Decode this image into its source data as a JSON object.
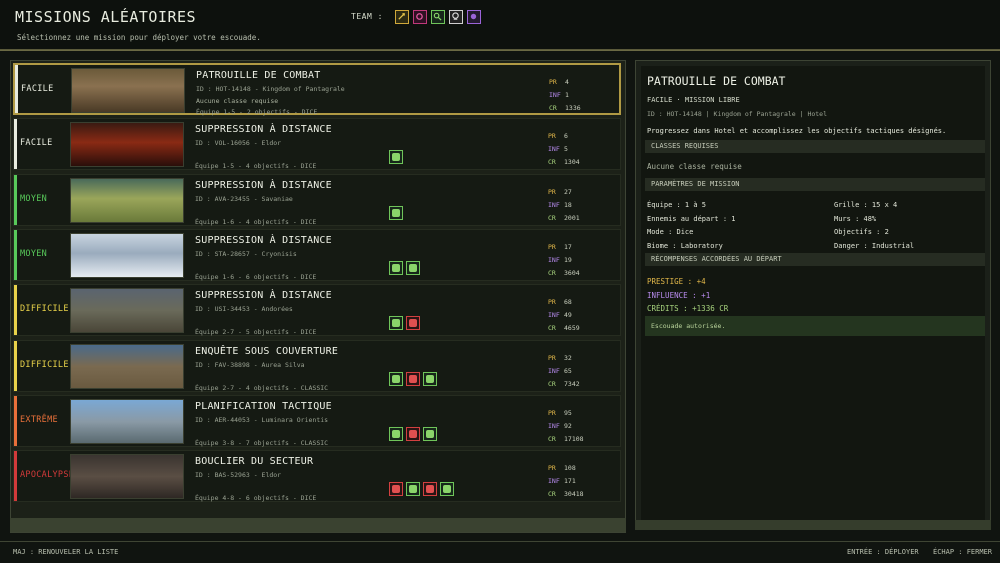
{
  "header": {
    "title": "MISSIONS ALÉATOIRES",
    "subtitle": "Sélectionnez une mission pour déployer votre escouade.",
    "team_label": "TEAM :",
    "team_icons": [
      "sword-class-icon",
      "bomb-class-icon",
      "scope-class-icon",
      "skull-class-icon",
      "rune-class-icon"
    ]
  },
  "colors": {
    "easy": "#e8ecdf",
    "medium": "#58c95a",
    "hard": "#e8d24a",
    "extreme": "#e8703a",
    "apocalypse": "#d23a3a",
    "selected_border": "#b09a44"
  },
  "missions": [
    {
      "difficulty": "FACILE",
      "name": "PATROUILLE DE COMBAT",
      "id_line": "ID : HOT-14148   -   Kingdom of Pantagrale",
      "requirement": "Aucune classe requise",
      "team_line": "Équipe 1-5    -    2 objectifs    -    DICE",
      "pr": "4",
      "inf": "1",
      "cr": "1336",
      "classes": []
    },
    {
      "difficulty": "FACILE",
      "name": "SUPPRESSION À DISTANCE",
      "id_line": "ID : VOL-16056   -   Eldor",
      "requirement": "",
      "team_line": "Équipe 1-5    -    4 objectifs    -    DICE",
      "pr": "6",
      "inf": "5",
      "cr": "1304",
      "classes": [
        "green"
      ]
    },
    {
      "difficulty": "MOYEN",
      "name": "SUPPRESSION À DISTANCE",
      "id_line": "ID : AVA-23455   -   Savaniae",
      "requirement": "",
      "team_line": "Équipe 1-6    -    4 objectifs    -    DICE",
      "pr": "27",
      "inf": "18",
      "cr": "2001",
      "classes": [
        "green"
      ]
    },
    {
      "difficulty": "MOYEN",
      "name": "SUPPRESSION À DISTANCE",
      "id_line": "ID : STA-28657   -   Cryonisis",
      "requirement": "",
      "team_line": "Équipe 1-6    -    6 objectifs    -    DICE",
      "pr": "17",
      "inf": "19",
      "cr": "3604",
      "classes": [
        "green",
        "green"
      ]
    },
    {
      "difficulty": "DIFFICILE",
      "name": "SUPPRESSION À DISTANCE",
      "id_line": "ID : USI-34453   -   Andorées",
      "requirement": "",
      "team_line": "Équipe 2-7    -    5 objectifs    -    DICE",
      "pr": "68",
      "inf": "49",
      "cr": "4659",
      "classes": [
        "green",
        "red"
      ]
    },
    {
      "difficulty": "DIFFICILE",
      "name": "ENQUÊTE SOUS COUVERTURE",
      "id_line": "ID : FAV-38898   -   Aurea Silva",
      "requirement": "",
      "team_line": "Équipe 2-7    -    4 objectifs    -    CLASSIC",
      "pr": "32",
      "inf": "65",
      "cr": "7342",
      "classes": [
        "green",
        "red",
        "green"
      ]
    },
    {
      "difficulty": "EXTRÊME",
      "name": "PLANIFICATION TACTIQUE",
      "id_line": "ID : AER-44053   -   Luminara Orientis",
      "requirement": "",
      "team_line": "Équipe 3-8    -    7 objectifs    -    CLASSIC",
      "pr": "95",
      "inf": "92",
      "cr": "17108",
      "classes": [
        "green",
        "red",
        "green"
      ]
    },
    {
      "difficulty": "APOCALYPSE",
      "name": "BOUCLIER DU SECTEUR",
      "id_line": "ID : BAS-52963   -   Eldor",
      "requirement": "",
      "team_line": "Équipe 4-8    -    6 objectifs    -    DICE",
      "pr": "108",
      "inf": "171",
      "cr": "30418",
      "classes": [
        "red",
        "green",
        "red",
        "green"
      ]
    }
  ],
  "stat_labels": {
    "pr": "PR",
    "inf": "INF",
    "cr": "CR"
  },
  "detail": {
    "title": "PATROUILLE DE COMBAT",
    "tags": "FACILE  ·  MISSION LIBRE",
    "ids": "ID : HOT-14148  |  Kingdom of Pantagrale  |  Hotel",
    "description": "Progressez dans Hotel et accomplissez les objectifs tactiques désignés.",
    "classes_header": "CLASSES REQUISES",
    "classes_value": "Aucune classe requise",
    "params_header": "PARAMÈTRES DE MISSION",
    "params_left": [
      "Équipe : 1 à 5",
      "Ennemis au départ : 1",
      "Mode : Dice",
      "Biome : Laboratory"
    ],
    "params_right": [
      "Grille : 15 x 4",
      "Murs : 48%",
      "Objectifs : 2",
      "Danger : Industrial"
    ],
    "rewards_header": "RÉCOMPENSES ACCORDÉES AU DÉPART",
    "reward_prestige": "PRESTIGE : +4",
    "reward_influence": "INFLUENCE : +1",
    "reward_credits": "CRÉDITS : +1336 CR",
    "authorized": "Escouade autorisée."
  },
  "footer": {
    "left": "MAJ : RENOUVELER LA LISTE",
    "deploy": "ENTRÉE : DÉPLOYER",
    "close": "ÉCHAP : FERMER"
  }
}
